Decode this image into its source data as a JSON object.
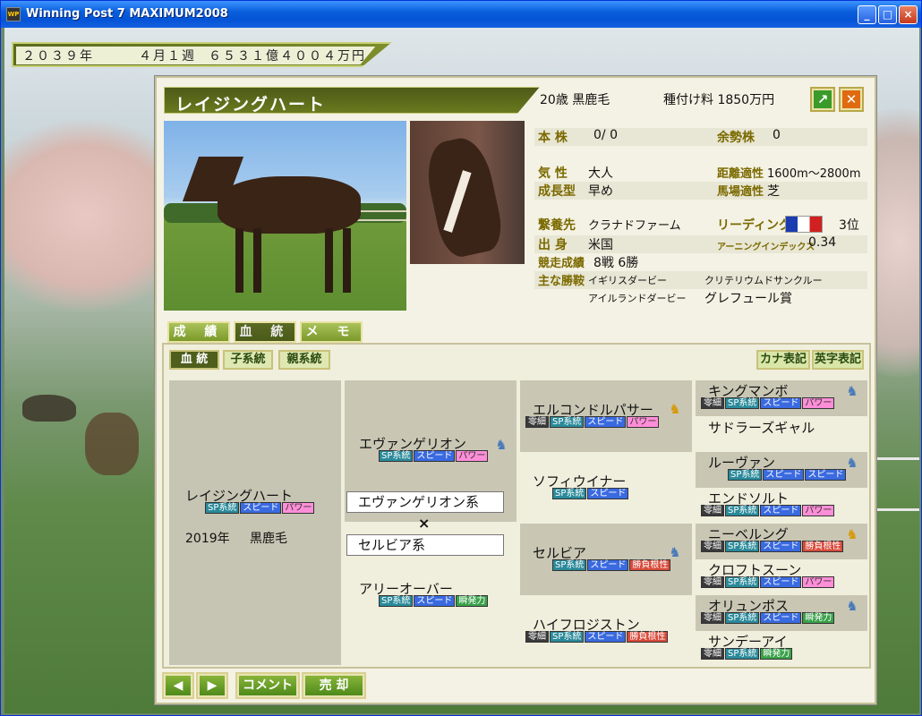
{
  "window": {
    "title": "Winning Post 7 MAXIMUM2008",
    "min": "_",
    "max": "□",
    "close": "×"
  },
  "infobar": {
    "year": "２０３９年",
    "week": "４月１週",
    "money": "６５３１億４００４万円"
  },
  "horse": {
    "name": "レイジングハート",
    "age_color": "20歳 黒鹿毛",
    "stud_fee": "種付け料 1850万円"
  },
  "header_buttons": {
    "go": "↗",
    "close": "✕"
  },
  "stats": {
    "honkabu_label": "本 株",
    "honkabu_value": "0/ 0",
    "yoseikabu_label": "余勢株",
    "yoseikabu_value": "0",
    "kishou_label": "気 性",
    "kishou_value": "大人",
    "kyori_label": "距離適性",
    "kyori_value": "1600m〜2800m",
    "seichou_label": "成長型",
    "seichou_value": "早め",
    "baba_label": "馬場適性",
    "baba_value": "芝",
    "keiyou_label": "繋養先",
    "keiyou_value": "クラナドファーム",
    "leading_label": "リーディング",
    "leading_value": "3位",
    "shusshin_label": "出 身",
    "shusshin_value": "米国",
    "aei_label": "アーニングインデックス",
    "aei_value": "0.34",
    "race_label": "競走成績",
    "race_value": "8戦 6勝",
    "wins_label": "主な勝鞍",
    "wins": [
      "イギリスダービー",
      "クリテリウムドサンクルー",
      "アイルランドダービー",
      "グレフュール賞"
    ]
  },
  "tabs": [
    "成 績",
    "血 統",
    "メ モ"
  ],
  "subtabs": [
    "血 統",
    "子系統",
    "親系統"
  ],
  "right_tabs": [
    "カナ表記",
    "英字表記"
  ],
  "pedigree": {
    "self": {
      "name": "レイジングハート",
      "tags": [
        "SP系統",
        "スピード",
        "パワー"
      ],
      "birth": "2019年",
      "color": "黒鹿毛"
    },
    "sire": {
      "name": "エヴァンゲリオン",
      "tags": [
        "SP系統",
        "スピード",
        "パワー"
      ]
    },
    "sire_line": "エヴァンゲリオン系",
    "cross": "×",
    "dam_line": "セルビア系",
    "dam": {
      "name": "アリーオーバー",
      "tags": [
        "SP系統",
        "スピード",
        "瞬発力"
      ]
    },
    "g2": [
      {
        "name": "エルコンドルパサー",
        "tags": [
          "零細",
          "SP系統",
          "スピード",
          "パワー"
        ]
      },
      {
        "name": "ソフィウイナー",
        "tags": [
          "SP系統",
          "スピード"
        ]
      },
      {
        "name": "セルビア",
        "tags": [
          "SP系統",
          "スピード",
          "勝負根性"
        ]
      },
      {
        "name": "ハイフロジストン",
        "tags": [
          "零細",
          "SP系統",
          "スピード",
          "勝負根性"
        ]
      }
    ],
    "g3": [
      {
        "name": "キングマンボ",
        "tags": [
          "零細",
          "SP系統",
          "スピード",
          "パワー"
        ]
      },
      {
        "name": "サドラーズギャル",
        "tags": []
      },
      {
        "name": "ルーヴァン",
        "tags": [
          "SP系統",
          "スピード",
          "スピード"
        ]
      },
      {
        "name": "エンドソルト",
        "tags": [
          "零細",
          "SP系統",
          "スピード",
          "パワー"
        ]
      },
      {
        "name": "ニーベルング",
        "tags": [
          "零細",
          "SP系統",
          "スピード",
          "勝負根性"
        ]
      },
      {
        "name": "クロフトスーン",
        "tags": [
          "零細",
          "SP系統",
          "スピード",
          "パワー"
        ]
      },
      {
        "name": "オリュンポス",
        "tags": [
          "零細",
          "SP系統",
          "スピード",
          "瞬発力"
        ]
      },
      {
        "name": "サンデーアイ",
        "tags": [
          "零細",
          "SP系統",
          "瞬発力"
        ]
      }
    ]
  },
  "bottom": {
    "prev": "◀",
    "next": "▶",
    "comment": "コメント",
    "sell": "売 却"
  }
}
